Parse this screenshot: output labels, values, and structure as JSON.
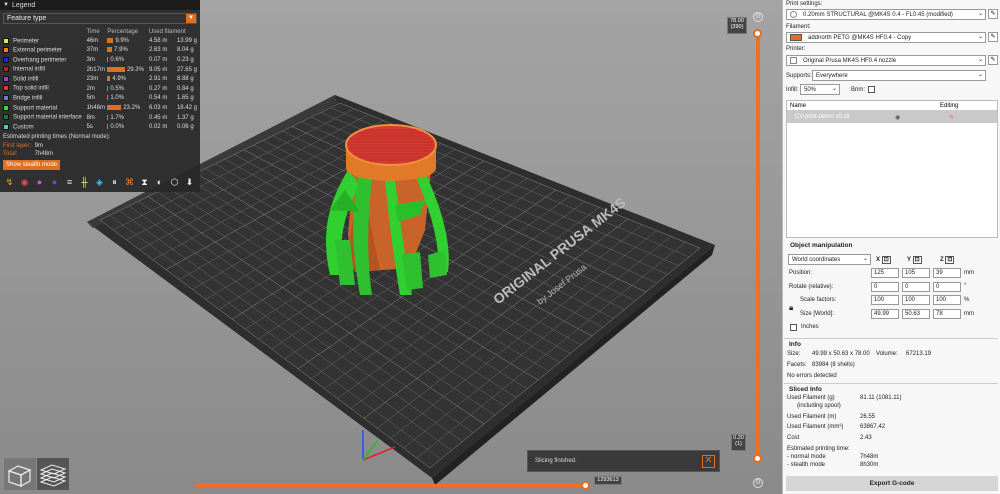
{
  "legend": {
    "title": "Legend",
    "view_type": "Feature type",
    "columns": [
      "",
      "Time",
      "Percentage",
      "Used filament"
    ],
    "features": [
      {
        "name": "Perimeter",
        "color": "#f0e050",
        "time": "46m",
        "percentage": "9.9%",
        "length": "4.58 m",
        "weight": "13.99 g",
        "pct": 9.9
      },
      {
        "name": "External perimeter",
        "color": "#f08020",
        "time": "37m",
        "percentage": "7.9%",
        "length": "2.63 m",
        "weight": "8.04 g",
        "pct": 7.9
      },
      {
        "name": "Overhang perimeter",
        "color": "#2020f0",
        "time": "3m",
        "percentage": "0.6%",
        "length": "0.07 m",
        "weight": "0.23 g",
        "pct": 0.6
      },
      {
        "name": "Internal infill",
        "color": "#b02020",
        "time": "2h17m",
        "percentage": "29.3%",
        "length": "9.05 m",
        "weight": "27.65 g",
        "pct": 29.3
      },
      {
        "name": "Solid infill",
        "color": "#a040c0",
        "time": "23m",
        "percentage": "4.9%",
        "length": "2.91 m",
        "weight": "8.88 g",
        "pct": 4.9
      },
      {
        "name": "Top solid infill",
        "color": "#f03030",
        "time": "2m",
        "percentage": "0.5%",
        "length": "0.27 m",
        "weight": "0.84 g",
        "pct": 0.5
      },
      {
        "name": "Bridge infill",
        "color": "#6080d0",
        "time": "5m",
        "percentage": "1.0%",
        "length": "0.54 m",
        "weight": "1.65 g",
        "pct": 1.0
      },
      {
        "name": "Support material",
        "color": "#30e030",
        "time": "1h48m",
        "percentage": "23.2%",
        "length": "6.03 m",
        "weight": "18.42 g",
        "pct": 23.2
      },
      {
        "name": "Support material interface",
        "color": "#108030",
        "time": "8m",
        "percentage": "1.7%",
        "length": "0.45 m",
        "weight": "1.37 g",
        "pct": 1.7
      },
      {
        "name": "Custom",
        "color": "#50d0b0",
        "time": "5s",
        "percentage": "0.0%",
        "length": "0.02 m",
        "weight": "0.06 g",
        "pct": 0.0
      }
    ],
    "estimated_title": "Estimated printing times (Normal mode):",
    "first_layer_label": "First layer:",
    "first_layer_value": "9m",
    "total_label": "Total:",
    "total_value": "7h48m",
    "stealth_button": "Show stealth mode"
  },
  "viewport": {
    "bed_brand_1": "ORIGINAL PRUSA MK4S",
    "bed_brand_2": "by Josef Prusa",
    "top_layer_height": "78.00",
    "top_layer_number": "(390)",
    "bottom_layer_height": "0.20",
    "bottom_layer_number": "(1)",
    "horizontal_position": "1293613",
    "toast_text": "Slicing finished."
  },
  "panel": {
    "print_settings_label": "Print settings:",
    "print_settings_value": "0.20mm STRUCTURAL @MK4S 0.4 - FL0.45 (modified)",
    "filament_label": "Filament:",
    "filament_value": "addnorth PETG @MK4S HF0.4 - Copy",
    "printer_label": "Printer:",
    "printer_value": "Original Prusa MK4S HF0.4 nozzle",
    "supports_label": "Supports:",
    "supports_value": "Everywhere",
    "infill_label": "Infill:",
    "infill_value": "50%",
    "brim_label": "Brim:",
    "list_name_col": "Name",
    "list_editing_col": "Editing",
    "object_name": "CV-print-demo v5.stl",
    "object_manipulation_title": "Object manipulation",
    "coordinates_value": "World coordinates",
    "axis_x": "X",
    "axis_y": "Y",
    "axis_z": "Z",
    "position_label": "Position:",
    "position": [
      "125",
      "105",
      "39"
    ],
    "position_unit": "mm",
    "rotate_label": "Rotate (relative):",
    "rotate": [
      "0",
      "0",
      "0"
    ],
    "rotate_unit": "°",
    "scale_label": "Scale factors:",
    "scale": [
      "100",
      "100",
      "100"
    ],
    "scale_unit": "%",
    "size_label": "Size [World]:",
    "size": [
      "49.99",
      "50.63",
      "78"
    ],
    "size_unit": "mm",
    "inches_label": "Inches",
    "info_title": "Info",
    "size_info_label": "Size:",
    "size_info_value": "49.99 x 50.63 x 78.00",
    "volume_label": "Volume:",
    "volume_value": "67213.19",
    "facets_label": "Facets:",
    "facets_value": "83984 (8 shells)",
    "errors_text": "No errors detected",
    "sliced_title": "Sliced Info",
    "used_g_label": "Used Filament (g)",
    "used_g_sub": "(including spool)",
    "used_g_value": "81.11 (1081.11)",
    "used_m_label": "Used Filament (m)",
    "used_m_value": "26.55",
    "used_mm3_label": "Used Filament (mm³)",
    "used_mm3_value": "63867.42",
    "cost_label": "Cost",
    "cost_value": "2.43",
    "est_label": "Estimated printing time:",
    "normal_label": "- normal mode",
    "normal_value": "7h48m",
    "stealth_label": "- stealth mode",
    "stealth_value": "8h30m",
    "export_button": "Export G-code"
  }
}
